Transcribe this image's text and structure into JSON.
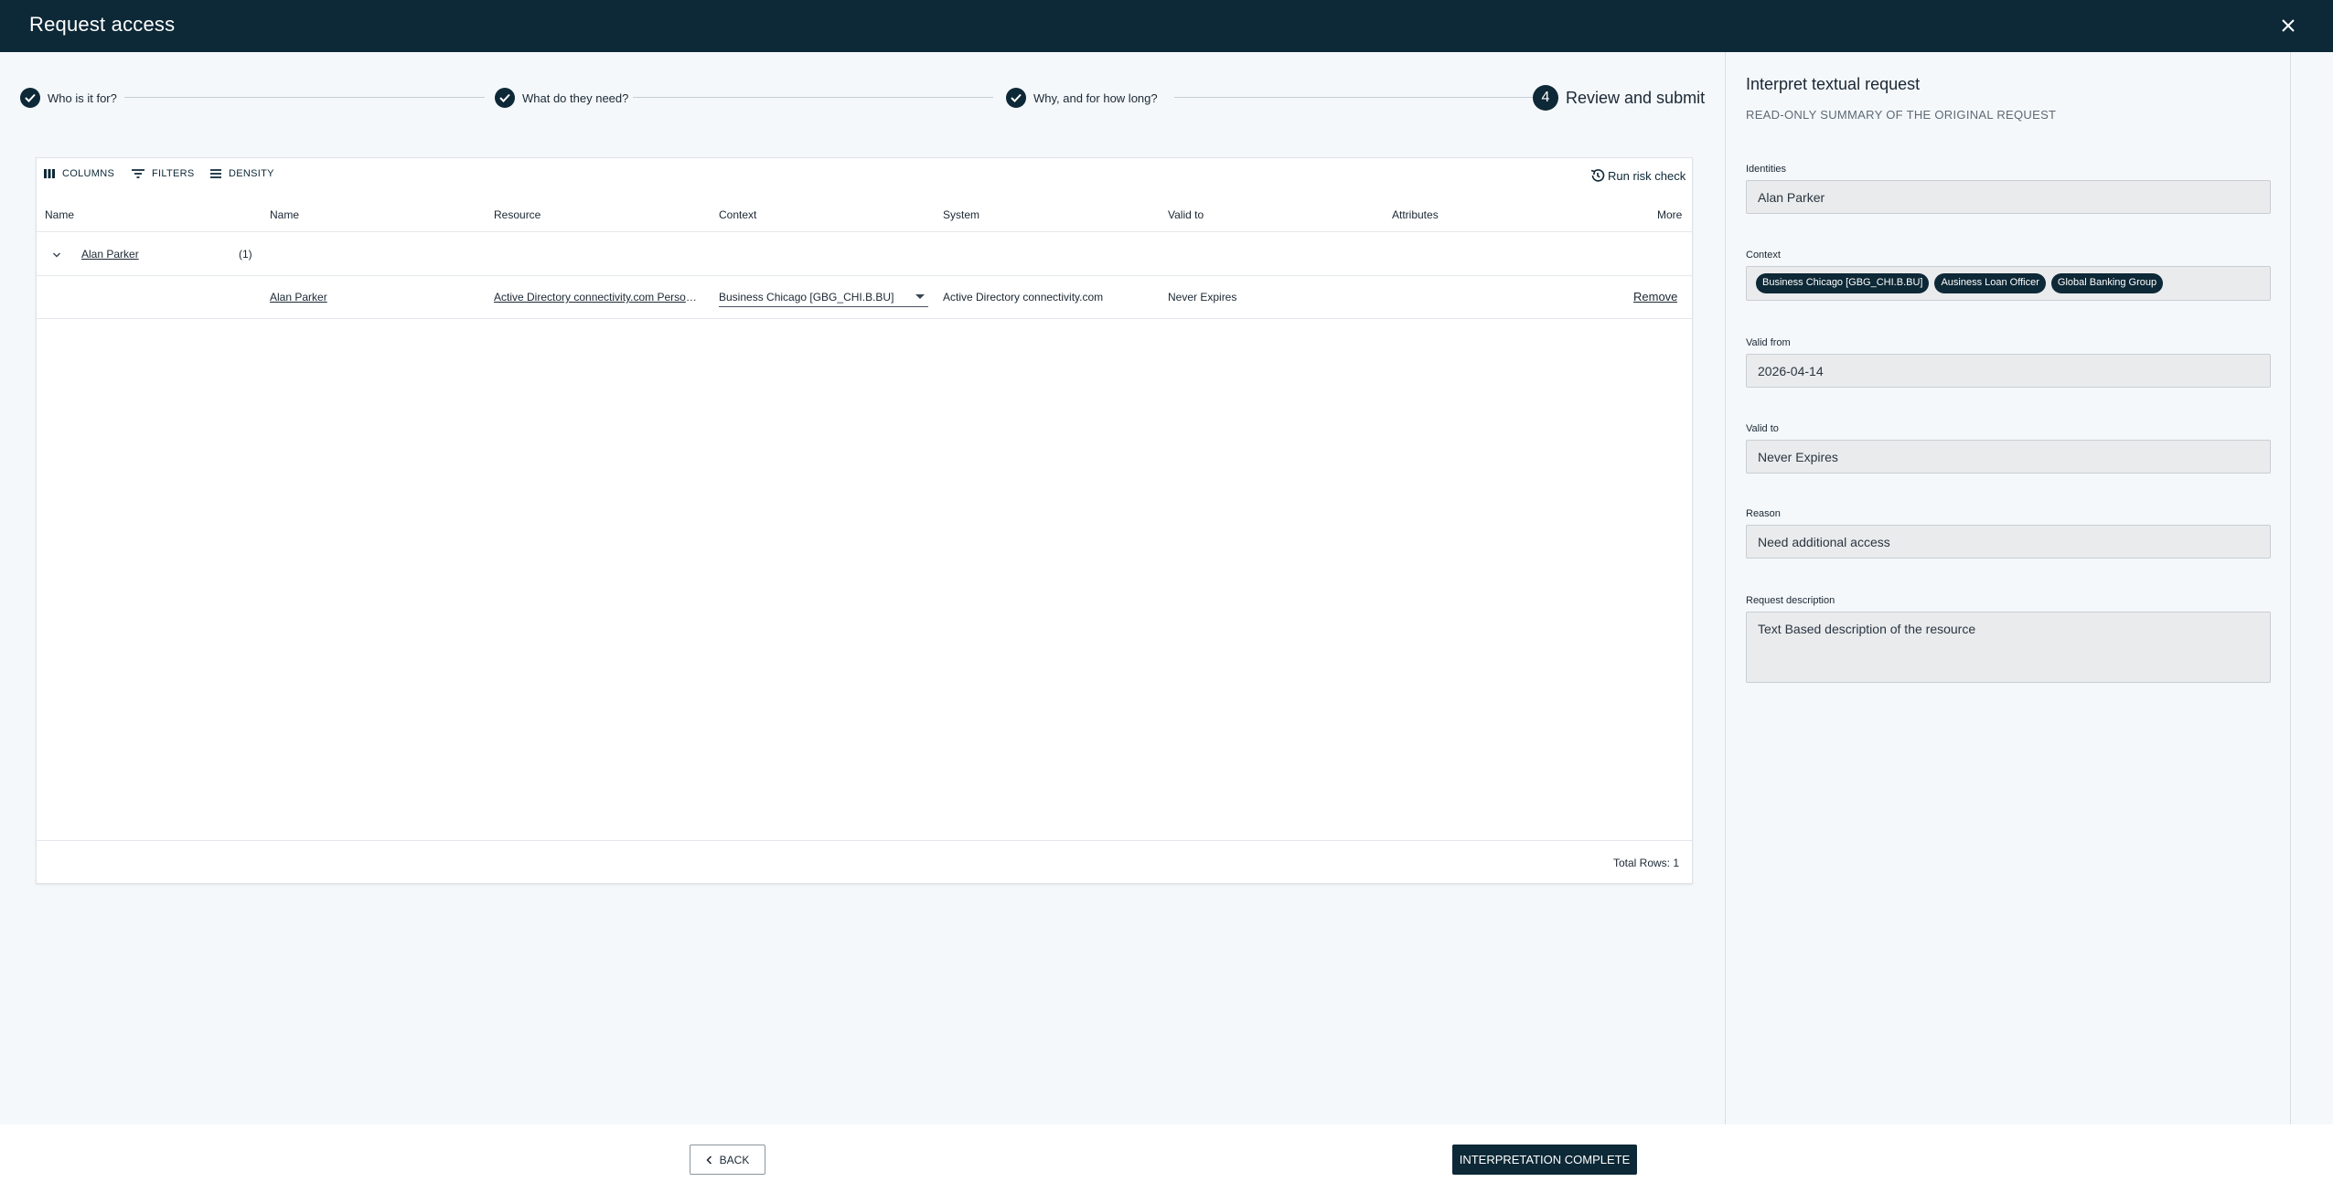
{
  "header": {
    "title": "Request access",
    "close_icon": "close-icon"
  },
  "stepper": {
    "steps": [
      {
        "label": "Who is it for?",
        "state": "complete"
      },
      {
        "label": "What do they need?",
        "state": "complete"
      },
      {
        "label": "Why, and for how long?",
        "state": "complete"
      },
      {
        "number": "4",
        "label": "Review and submit",
        "state": "current"
      }
    ]
  },
  "grid": {
    "toolbar": {
      "columns": "COLUMNS",
      "filters": "FILTERS",
      "density": "DENSITY",
      "risk_check": "Run risk check"
    },
    "columns": [
      "Name",
      "Name",
      "Resource",
      "Context",
      "System",
      "Valid to",
      "Attributes",
      "More"
    ],
    "group_row": {
      "name": "Alan Parker",
      "count": "(1)"
    },
    "rows": [
      {
        "name": "Alan Parker",
        "resource": "Active Directory connectivity.com Person Access",
        "context": "Business Chicago [GBG_CHI.B.BU]",
        "system": "Active Directory connectivity.com",
        "valid_to": "Never Expires",
        "action": "Remove"
      }
    ],
    "footer": {
      "total_rows": "Total Rows: 1"
    }
  },
  "side_panel": {
    "title": "Interpret textual request",
    "subtitle": "READ-ONLY SUMMARY OF THE ORIGINAL REQUEST",
    "fields": {
      "identities": {
        "label": "Identities",
        "value": "Alan Parker"
      },
      "context": {
        "label": "Context",
        "chips": [
          "Business Chicago [GBG_CHI.B.BU]",
          "Ausiness Loan Officer",
          "Global Banking Group"
        ]
      },
      "valid_from": {
        "label": "Valid from",
        "value": "2026-04-14"
      },
      "valid_to": {
        "label": "Valid to",
        "value": "Never Expires"
      },
      "reason": {
        "label": "Reason",
        "value": "Need additional access"
      },
      "request_description": {
        "label": "Request description",
        "value": "Text Based description of the resource"
      }
    }
  },
  "actions": {
    "back": "BACK",
    "complete": "INTERPRETATION COMPLETE"
  },
  "colors": {
    "primary": "#0d2836",
    "background": "#f4f8fb",
    "field_bg": "#e9ebed"
  }
}
